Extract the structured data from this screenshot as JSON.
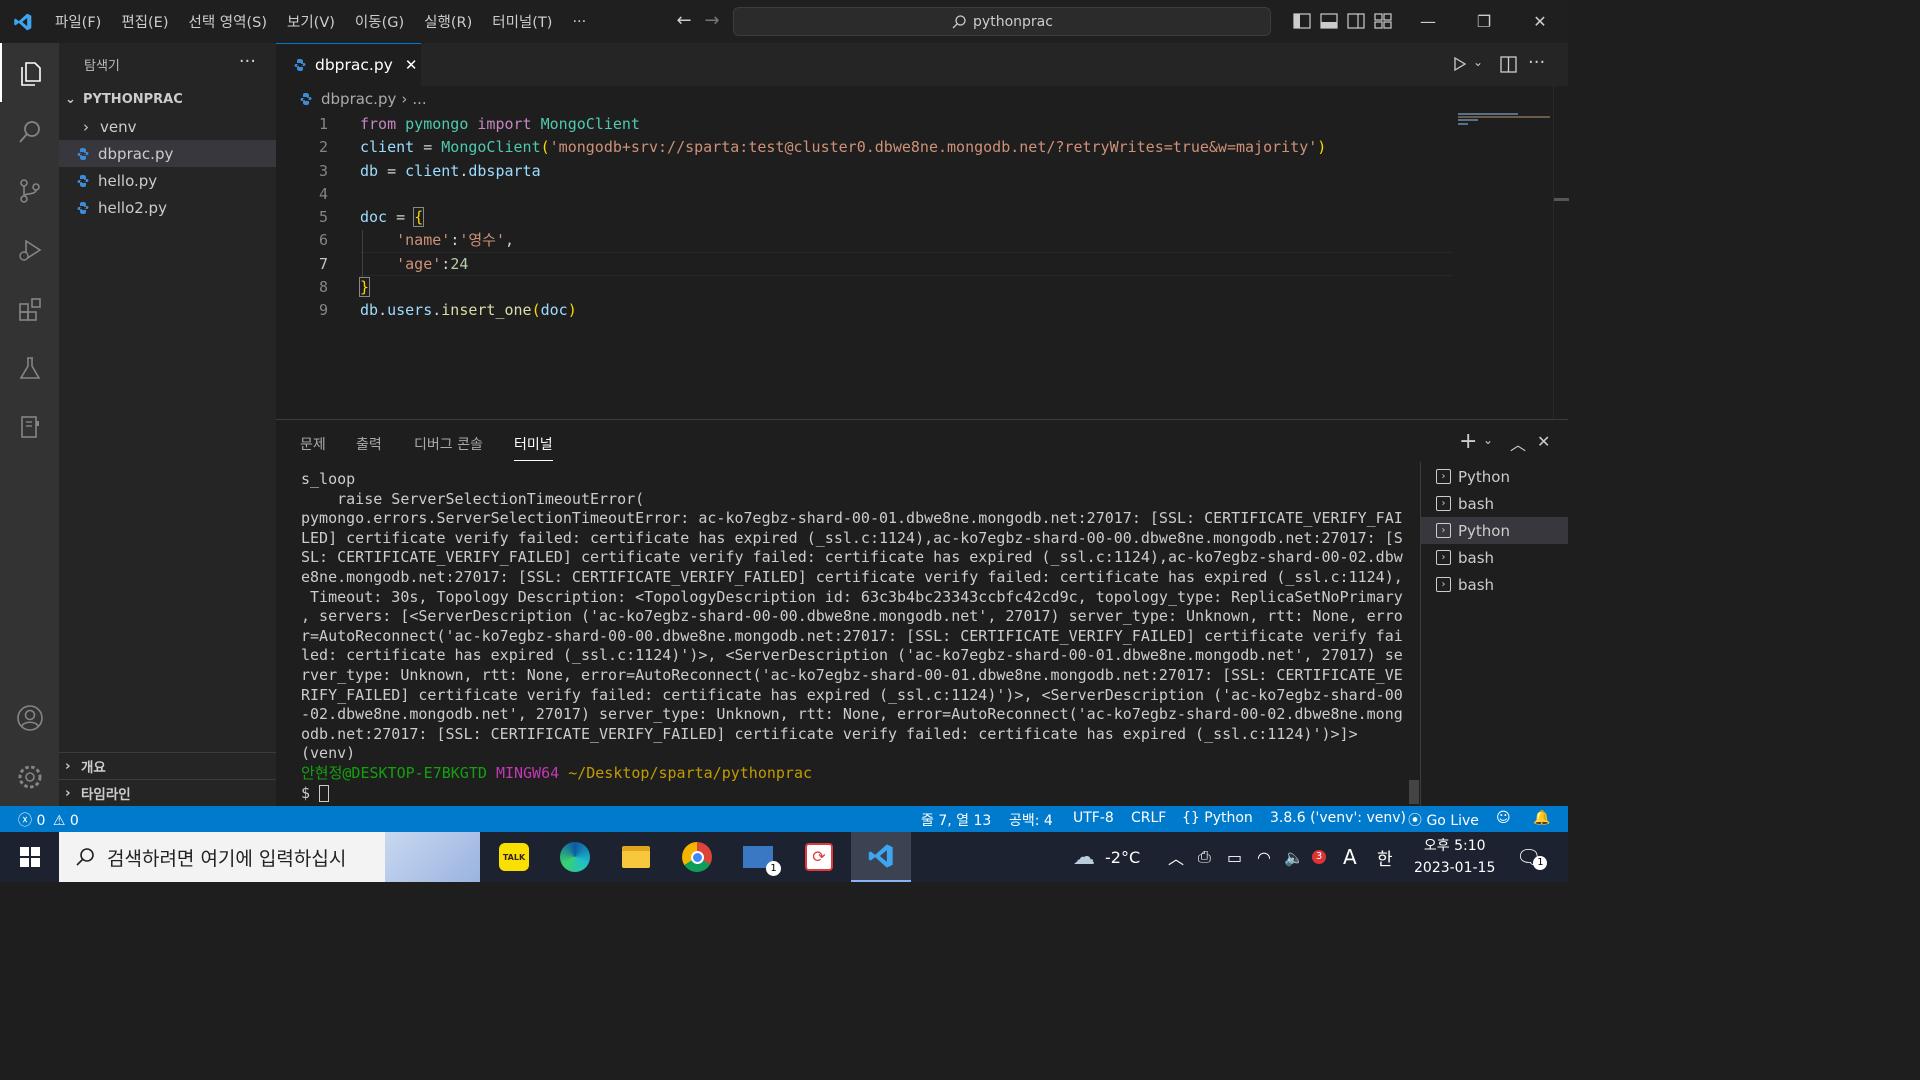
{
  "menu": [
    "파일(F)",
    "편집(E)",
    "선택 영역(S)",
    "보기(V)",
    "이동(G)",
    "실행(R)",
    "터미널(T)",
    "···"
  ],
  "command_center": {
    "text": "pythonprac"
  },
  "sidebar": {
    "title": "탐색기",
    "more": "···",
    "project": "PYTHONPRAC",
    "items": [
      {
        "label": "venv",
        "type": "folder"
      },
      {
        "label": "dbprac.py",
        "type": "python",
        "selected": true
      },
      {
        "label": "hello.py",
        "type": "python"
      },
      {
        "label": "hello2.py",
        "type": "python"
      }
    ],
    "sections": [
      "개요",
      "타임라인"
    ]
  },
  "editor": {
    "tab_label": "dbprac.py",
    "breadcrumb_file": "dbprac.py",
    "breadcrumb_rest": "...",
    "line_numbers": [
      "1",
      "2",
      "3",
      "4",
      "5",
      "6",
      "7",
      "8",
      "9"
    ]
  },
  "panel": {
    "tabs": [
      "문제",
      "출력",
      "디버그 콘솔",
      "터미널"
    ],
    "active_tab": "터미널",
    "terminal_lines": [
      "s_loop",
      "    raise ServerSelectionTimeoutError(",
      "pymongo.errors.ServerSelectionTimeoutError: ac-ko7egbz-shard-00-01.dbwe8ne.mongodb.net:27017: [SSL: CERTIFICATE_VERIFY_FAI",
      "LED] certificate verify failed: certificate has expired (_ssl.c:1124),ac-ko7egbz-shard-00-00.dbwe8ne.mongodb.net:27017: [S",
      "SL: CERTIFICATE_VERIFY_FAILED] certificate verify failed: certificate has expired (_ssl.c:1124),ac-ko7egbz-shard-00-02.dbw",
      "e8ne.mongodb.net:27017: [SSL: CERTIFICATE_VERIFY_FAILED] certificate verify failed: certificate has expired (_ssl.c:1124),",
      " Timeout: 30s, Topology Description: <TopologyDescription id: 63c3b4bc23343ccbfc42cd9c, topology_type: ReplicaSetNoPrimary",
      ", servers: [<ServerDescription ('ac-ko7egbz-shard-00-00.dbwe8ne.mongodb.net', 27017) server_type: Unknown, rtt: None, erro",
      "r=AutoReconnect('ac-ko7egbz-shard-00-00.dbwe8ne.mongodb.net:27017: [SSL: CERTIFICATE_VERIFY_FAILED] certificate verify fai",
      "led: certificate has expired (_ssl.c:1124)')>, <ServerDescription ('ac-ko7egbz-shard-00-01.dbwe8ne.mongodb.net', 27017) se",
      "rver_type: Unknown, rtt: None, error=AutoReconnect('ac-ko7egbz-shard-00-01.dbwe8ne.mongodb.net:27017: [SSL: CERTIFICATE_VE",
      "RIFY_FAILED] certificate verify failed: certificate has expired (_ssl.c:1124)')>, <ServerDescription ('ac-ko7egbz-shard-00",
      "-02.dbwe8ne.mongodb.net', 27017) server_type: Unknown, rtt: None, error=AutoReconnect('ac-ko7egbz-shard-00-02.dbwe8ne.mong",
      "odb.net:27017: [SSL: CERTIFICATE_VERIFY_FAILED] certificate verify failed: certificate has expired (_ssl.c:1124)')>]>",
      "(venv)"
    ],
    "prompt_user": "안현정@DESKTOP-E7BKGTD",
    "prompt_env": "MINGW64",
    "prompt_path": "~/Desktop/sparta/pythonprac",
    "prompt_symbol": "$",
    "terminals": [
      {
        "label": "Python"
      },
      {
        "label": "bash"
      },
      {
        "label": "Python",
        "selected": true
      },
      {
        "label": "bash"
      },
      {
        "label": "bash"
      }
    ]
  },
  "statusbar": {
    "errors": "0",
    "warnings": "0",
    "position": "줄 7, 열 13",
    "spaces": "공백: 4",
    "encoding": "UTF-8",
    "eol": "CRLF",
    "language": "Python",
    "interpreter": "3.8.6 ('venv': venv)",
    "golive": "Go Live"
  },
  "taskbar": {
    "search_placeholder": "검색하려면 여기에 입력하십시",
    "weather": "-2°C",
    "ime": "A",
    "ime2": "한",
    "time": "오후 5:10",
    "date": "2023-01-15",
    "notification_count": "1",
    "mail_badge": "1",
    "kakao_label": "TALK",
    "tray_badge": "3"
  },
  "colors": {
    "accent": "#007acc",
    "activity": "#333333",
    "sidebar": "#252526",
    "editor": "#1e1e1e"
  }
}
